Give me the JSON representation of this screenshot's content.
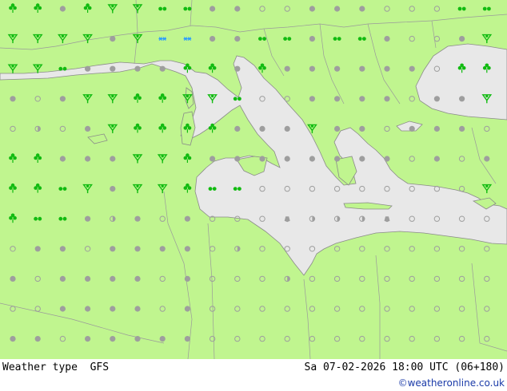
{
  "footer": {
    "title": "Weather type  GFS",
    "datetime": "Sa 07-02-2026 18:00 UTC (06+180)",
    "credit": "©weatheronline.co.uk"
  },
  "colors": {
    "land": "#c0f58f",
    "sea": "#e8e8e8",
    "border": "#9a9a9a",
    "coast": "#8a8a8a",
    "rain": "#11bb11",
    "snow": "#2a9cff",
    "cloud": "#9e9e9e"
  },
  "symbol_types": [
    "rain",
    "showers",
    "thunder-showers",
    "drizzle",
    "snow",
    "overcast",
    "cloudy",
    "partly-cloudy",
    "clear"
  ],
  "grid": {
    "rows": [
      [
        "showers",
        "showers",
        "cloudy",
        "showers",
        "thunder-showers",
        "thunder-showers",
        "drizzle",
        "drizzle",
        "cloudy",
        "cloudy",
        "clear",
        "clear",
        "cloudy",
        "cloudy",
        "cloudy",
        "clear",
        "clear",
        "clear",
        "drizzle",
        "drizzle",
        "drizzle"
      ],
      [
        "thunder-showers",
        "thunder-showers",
        "thunder-showers",
        "thunder-showers",
        "cloudy",
        "thunder-showers",
        "snow",
        "snow",
        "cloudy",
        "cloudy",
        "drizzle",
        "drizzle",
        "cloudy",
        "drizzle",
        "drizzle",
        "cloudy",
        "clear",
        "clear",
        "cloudy",
        "thunder-showers",
        "showers"
      ],
      [
        "thunder-showers",
        "thunder-showers",
        "drizzle",
        "cloudy",
        "cloudy",
        "cloudy",
        "cloudy",
        "showers",
        "showers",
        "cloudy",
        "showers",
        "cloudy",
        "cloudy",
        "cloudy",
        "cloudy",
        "cloudy",
        "cloudy",
        "clear",
        "showers",
        "showers",
        "showers"
      ],
      [
        "cloudy",
        "clear",
        "cloudy",
        "thunder-showers",
        "thunder-showers",
        "showers",
        "showers",
        "thunder-showers",
        "thunder-showers",
        "drizzle",
        "clear",
        "clear",
        "cloudy",
        "cloudy",
        "cloudy",
        "cloudy",
        "clear",
        "cloudy",
        "cloudy",
        "thunder-showers",
        "thunder-showers"
      ],
      [
        "clear",
        "partly-cloudy",
        "clear",
        "cloudy",
        "thunder-showers",
        "showers",
        "showers",
        "showers",
        "showers",
        "cloudy",
        "cloudy",
        "cloudy",
        "thunder-showers",
        "cloudy",
        "cloudy",
        "clear",
        "cloudy",
        "cloudy",
        "cloudy",
        "clear",
        "thunder-showers"
      ],
      [
        "showers",
        "showers",
        "cloudy",
        "cloudy",
        "cloudy",
        "thunder-showers",
        "thunder-showers",
        "showers",
        "cloudy",
        "cloudy",
        "cloudy",
        "cloudy",
        "cloudy",
        "cloudy",
        "cloudy",
        "cloudy",
        "clear",
        "cloudy",
        "clear",
        "cloudy",
        "clear"
      ],
      [
        "showers",
        "showers",
        "drizzle",
        "thunder-showers",
        "cloudy",
        "thunder-showers",
        "thunder-showers",
        "showers",
        "drizzle",
        "drizzle",
        "clear",
        "clear",
        "clear",
        "clear",
        "clear",
        "clear",
        "clear",
        "clear",
        "clear",
        "thunder-showers",
        "clear"
      ],
      [
        "showers",
        "drizzle",
        "drizzle",
        "cloudy",
        "partly-cloudy",
        "cloudy",
        "clear",
        "cloudy",
        "clear",
        "clear",
        "clear",
        "overcast",
        "partly-cloudy",
        "partly-cloudy",
        "partly-cloudy",
        "overcast",
        "clear",
        "clear",
        "clear",
        "clear",
        "clear"
      ],
      [
        "clear",
        "cloudy",
        "cloudy",
        "clear",
        "cloudy",
        "cloudy",
        "cloudy",
        "cloudy",
        "clear",
        "partly-cloudy",
        "clear",
        "clear",
        "clear",
        "clear",
        "clear",
        "clear",
        "clear",
        "clear",
        "clear",
        "clear",
        "clear"
      ],
      [
        "cloudy",
        "clear",
        "cloudy",
        "cloudy",
        "cloudy",
        "cloudy",
        "clear",
        "cloudy",
        "clear",
        "clear",
        "clear",
        "partly-cloudy",
        "clear",
        "clear",
        "clear",
        "clear",
        "clear",
        "clear",
        "clear",
        "clear",
        "clear"
      ],
      [
        "clear",
        "clear",
        "cloudy",
        "cloudy",
        "cloudy",
        "cloudy",
        "clear",
        "cloudy",
        "clear",
        "clear",
        "clear",
        "clear",
        "clear",
        "clear",
        "clear",
        "clear",
        "clear",
        "clear",
        "clear",
        "clear",
        "clear"
      ],
      [
        "cloudy",
        "cloudy",
        "clear",
        "cloudy",
        "cloudy",
        "cloudy",
        "cloudy",
        "cloudy",
        "clear",
        "clear",
        "clear",
        "clear",
        "clear",
        "clear",
        "clear",
        "clear",
        "clear",
        "clear",
        "clear",
        "clear",
        "clear"
      ]
    ]
  }
}
